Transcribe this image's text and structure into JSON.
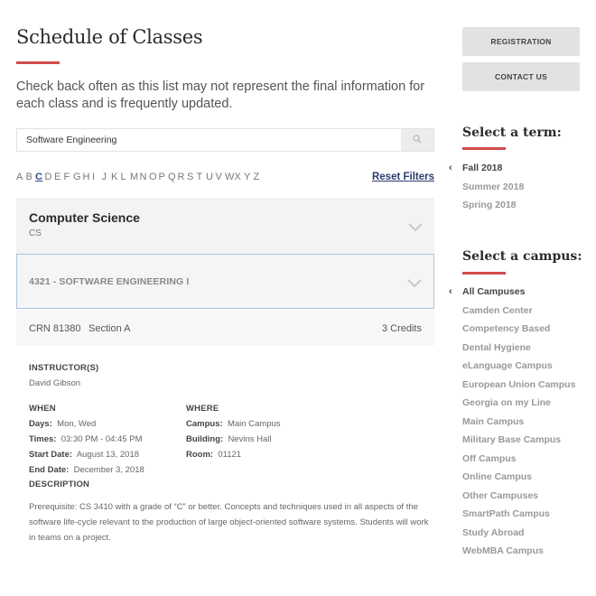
{
  "page": {
    "title": "Schedule of Classes",
    "intro": "Check back often as this list may not represent the final information for each class and is frequently updated."
  },
  "search": {
    "value": "Software Engineering",
    "placeholder": "",
    "icon": "search-icon"
  },
  "alphabet": {
    "letters": [
      "A",
      "B",
      "C",
      "D",
      "E",
      "F",
      "G",
      "H",
      "I",
      "J",
      "K",
      "L",
      "M",
      "N",
      "O",
      "P",
      "Q",
      "R",
      "S",
      "T",
      "U",
      "V",
      "W",
      "X",
      "Y",
      "Z"
    ],
    "active": "C",
    "reset_label": "Reset Filters"
  },
  "department": {
    "name": "Computer Science",
    "code": "CS",
    "icon": "chevron-down-icon"
  },
  "course": {
    "title": "4321 - SOFTWARE ENGINEERING I",
    "icon": "chevron-down-icon"
  },
  "section": {
    "crn": "CRN 81380",
    "section": "Section A",
    "credits": "3 Credits"
  },
  "details": {
    "instructor_heading": "INSTRUCTOR(S)",
    "instructor": "David Gibson",
    "when_heading": "WHEN",
    "where_heading": "WHERE",
    "when": [
      {
        "label": "Days:",
        "value": "Mon, Wed"
      },
      {
        "label": "Times:",
        "value": "03:30 PM - 04:45 PM"
      },
      {
        "label": "Start Date:",
        "value": "August 13, 2018"
      },
      {
        "label": "End Date:",
        "value": "December 3, 2018"
      }
    ],
    "where": [
      {
        "label": "Campus:",
        "value": "Main Campus"
      },
      {
        "label": "Building:",
        "value": "Nevins Hall"
      },
      {
        "label": "Room:",
        "value": "01121"
      }
    ],
    "description_heading": "DESCRIPTION",
    "description": "Prerequisite: CS 3410 with a grade of “C” or better. Concepts and techniques used in all aspects of the software life-cycle relevant to the production of large object-oriented software systems. Students will work in teams on a project."
  },
  "sidebar": {
    "buttons": [
      {
        "label": "REGISTRATION"
      },
      {
        "label": "CONTACT US"
      }
    ],
    "term_heading": "Select a term:",
    "terms": [
      {
        "label": "Fall 2018",
        "selected": true
      },
      {
        "label": "Summer 2018",
        "selected": false
      },
      {
        "label": "Spring 2018",
        "selected": false
      }
    ],
    "campus_heading": "Select a campus:",
    "campuses": [
      {
        "label": "All Campuses",
        "selected": true
      },
      {
        "label": "Camden Center",
        "selected": false
      },
      {
        "label": "Competency Based",
        "selected": false
      },
      {
        "label": "Dental Hygiene",
        "selected": false
      },
      {
        "label": "eLanguage Campus",
        "selected": false
      },
      {
        "label": "European Union Campus",
        "selected": false
      },
      {
        "label": "Georgia on my Line",
        "selected": false
      },
      {
        "label": "Main Campus",
        "selected": false
      },
      {
        "label": "Military Base Campus",
        "selected": false
      },
      {
        "label": "Off Campus",
        "selected": false
      },
      {
        "label": "Online Campus",
        "selected": false
      },
      {
        "label": "Other Campuses",
        "selected": false
      },
      {
        "label": "SmartPath Campus",
        "selected": false
      },
      {
        "label": "Study Abroad",
        "selected": false
      },
      {
        "label": "WebMBA Campus",
        "selected": false
      }
    ],
    "caret_glyph": "‹"
  },
  "colors": {
    "accent_red": "#d24b4b",
    "link_blue": "#2d3c6e",
    "focus_border": "#a9c4e3"
  }
}
